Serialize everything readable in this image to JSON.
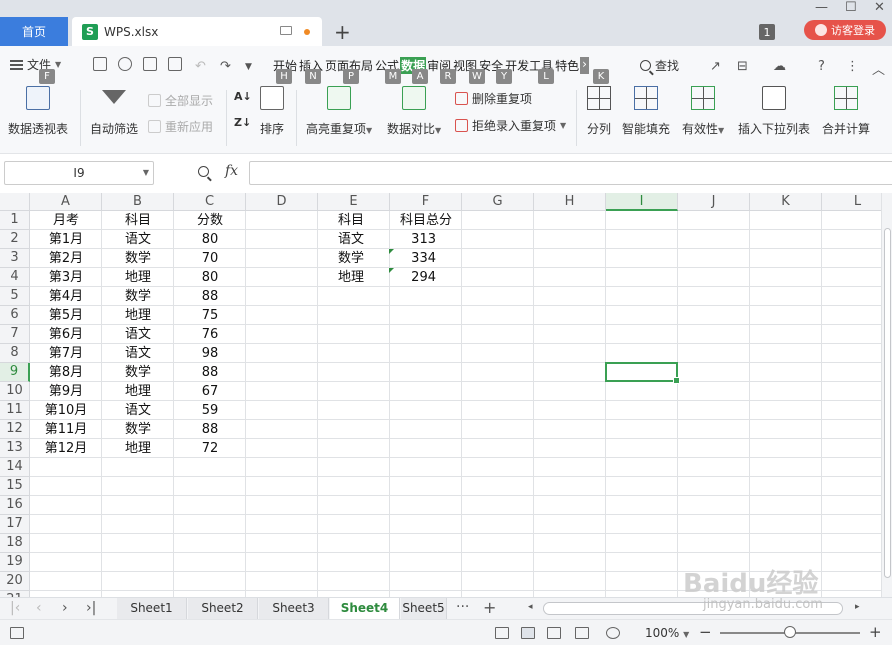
{
  "titlebar": {
    "home_tab": "首页",
    "doc_tab": {
      "icon": "S",
      "filename": "WPS.xlsx"
    },
    "new_tab": "+",
    "badge": "1",
    "visitor_login": "访客登录"
  },
  "menubar": {
    "file_label": "文件",
    "file_hotkey": "F",
    "tabs": [
      {
        "label": "开始",
        "hotkey": "H"
      },
      {
        "label": "插入",
        "hotkey": "N"
      },
      {
        "label": "页面布局",
        "hotkey": "P"
      },
      {
        "label": "公式",
        "hotkey": "M"
      },
      {
        "label": "数据",
        "hotkey": "A",
        "active": true
      },
      {
        "label": "审阅",
        "hotkey": "R"
      },
      {
        "label": "视图",
        "hotkey": "W"
      },
      {
        "label": "安全",
        "hotkey": "Y"
      },
      {
        "label": "开发工具",
        "hotkey": "L"
      },
      {
        "label": "特色",
        "hotkey": "K"
      }
    ],
    "search_label": "查找"
  },
  "ribbon": {
    "pivot": "数据透视表",
    "autofilter": "自动筛选",
    "show_all": "全部显示",
    "reapply": "重新应用",
    "sort": "排序",
    "highlight_dup": "高亮重复项",
    "compare": "数据对比",
    "remove_dup": "删除重复项",
    "reject_dup": "拒绝录入重复项",
    "split": "分列",
    "smart_fill": "智能填充",
    "validity": "有效性",
    "dropdown_list": "插入下拉列表",
    "merge_calc": "合并计算"
  },
  "formula": {
    "cell_ref": "I9",
    "fx": "fx",
    "value": ""
  },
  "sheet": {
    "columns": [
      "A",
      "B",
      "C",
      "D",
      "E",
      "F",
      "G",
      "H",
      "I",
      "J",
      "K",
      "L"
    ],
    "rows": [
      "1",
      "2",
      "3",
      "4",
      "5",
      "6",
      "7",
      "8",
      "9",
      "10",
      "11",
      "12",
      "13",
      "14",
      "15",
      "16",
      "17",
      "18",
      "19",
      "20",
      "21"
    ],
    "selected_col": "I",
    "selected_row": "9",
    "header_month": "月考",
    "header_subject": "科目",
    "header_score": "分数",
    "data": [
      [
        "第1月",
        "语文",
        "80"
      ],
      [
        "第2月",
        "数学",
        "70"
      ],
      [
        "第3月",
        "地理",
        "80"
      ],
      [
        "第4月",
        "数学",
        "88"
      ],
      [
        "第5月",
        "地理",
        "75"
      ],
      [
        "第6月",
        "语文",
        "76"
      ],
      [
        "第7月",
        "语文",
        "98"
      ],
      [
        "第8月",
        "数学",
        "88"
      ],
      [
        "第9月",
        "地理",
        "67"
      ],
      [
        "第10月",
        "语文",
        "59"
      ],
      [
        "第11月",
        "数学",
        "88"
      ],
      [
        "第12月",
        "地理",
        "72"
      ]
    ],
    "summary_header_subject": "科目",
    "summary_header_total": "科目总分",
    "summary": [
      [
        "语文",
        "313"
      ],
      [
        "数学",
        "334"
      ],
      [
        "地理",
        "294"
      ]
    ]
  },
  "sheets": {
    "tabs": [
      "Sheet1",
      "Sheet2",
      "Sheet3",
      "Sheet4",
      "Sheet5"
    ],
    "active": "Sheet4",
    "more": "···",
    "add": "+"
  },
  "status": {
    "zoom": "100%",
    "minus": "−",
    "plus": "+"
  },
  "watermark": {
    "logo_text": "Baidu经验",
    "url_text": "jingyan.baidu.com"
  }
}
